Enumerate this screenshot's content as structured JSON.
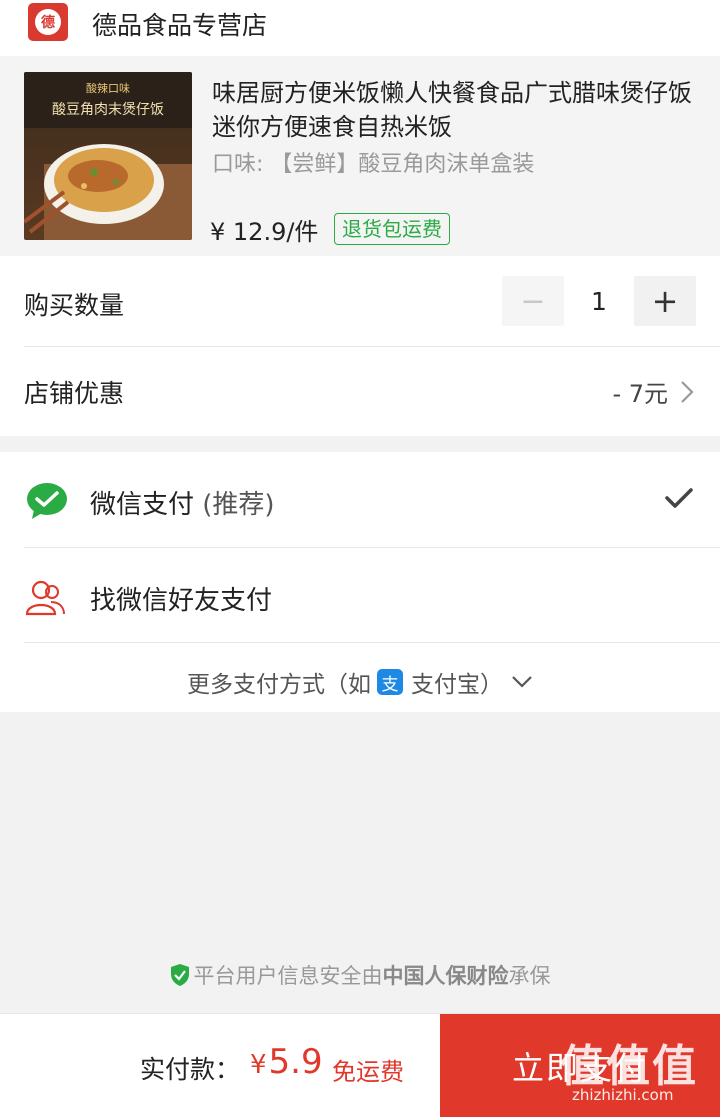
{
  "store": {
    "logo_text": "德",
    "name": "德品食品专营店"
  },
  "product": {
    "title": "味居厨方便米饭懒人快餐食品广式腊味煲仔饭迷你方便速食自热米饭",
    "flavor": "口味: 【尝鲜】酸豆角肉沫单盒装",
    "price": "¥ 12.9/件",
    "badge": "退货包运费",
    "image_caption_top": "酸辣口味",
    "image_caption_main": "酸豆角肉末煲仔饭"
  },
  "order": {
    "quantity_label": "购买数量",
    "quantity": "1",
    "minus": "−",
    "plus": "+",
    "discount_label": "店铺优惠",
    "discount_value": "- 7元"
  },
  "payment": {
    "wechat_label": "微信支付",
    "wechat_recommend": "(推荐)",
    "friend_label": "找微信好友支付",
    "more_prefix": "更多支付方式（如",
    "alipay_glyph": "支",
    "more_suffix": "支付宝）"
  },
  "safety": {
    "prefix": "平台用户信息安全由",
    "insurer": "中国人保财险",
    "suffix": "承保"
  },
  "bottom": {
    "total_label": "实付款：",
    "currency": "¥",
    "total": "5.9",
    "free_shipping": "免运费",
    "buy_button": "立即支付",
    "watermark": "值值值",
    "watermark_url": "zhizhizhi.com"
  },
  "colors": {
    "accent_red": "#e0392b",
    "wechat_green": "#2aab43",
    "alipay_blue": "#1e88e5"
  }
}
